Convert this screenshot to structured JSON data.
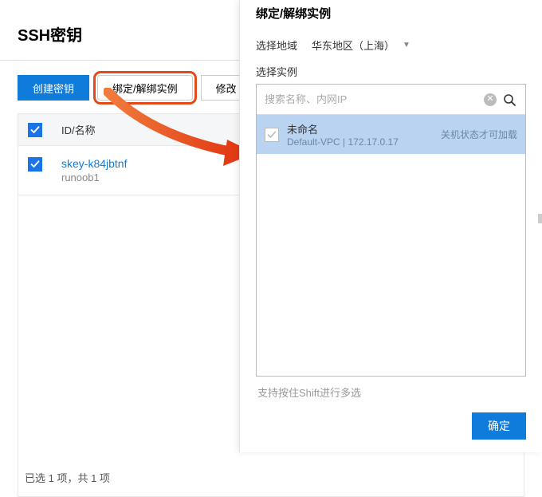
{
  "header": {
    "title": "SSH密钥"
  },
  "toolbar": {
    "create_label": "创建密钥",
    "bind_label": "绑定/解绑实例",
    "modify_label": "修改"
  },
  "table": {
    "columns": {
      "id_name": "ID/名称"
    },
    "rows": [
      {
        "id": "skey-k84jbtnf",
        "name": "runoob1"
      }
    ]
  },
  "footer": {
    "selection_text": "已选 1 项，共 1 项"
  },
  "panel": {
    "title": "绑定/解绑实例",
    "region_label": "选择地域",
    "region_value": "华东地区（上海）",
    "instance_label": "选择实例",
    "search_placeholder": "搜索名称、内网IP",
    "instances": [
      {
        "name": "未命名",
        "sub": "Default-VPC | 172.17.0.17",
        "hint": "关机状态才可加载"
      }
    ],
    "shift_hint": "支持按住Shift进行多选",
    "confirm_label": "确定"
  }
}
